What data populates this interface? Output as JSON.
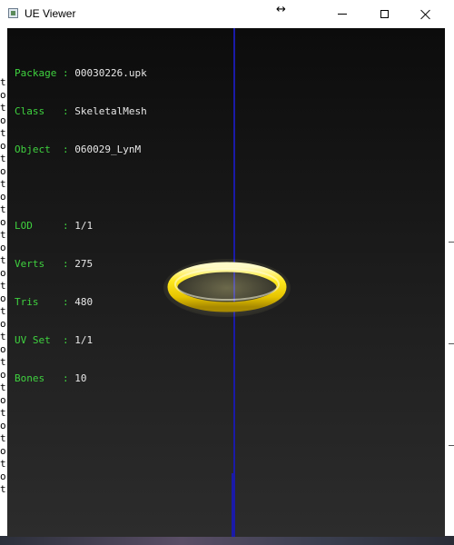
{
  "window": {
    "title": "UE Viewer",
    "icons": {
      "app": "app-window-icon",
      "resize": "horizontal-resize-cursor-icon",
      "minimize": "minimize-icon",
      "maximize": "maximize-icon",
      "close": "close-icon"
    },
    "resize_glyph": "↔"
  },
  "info": {
    "object": [
      {
        "key": "Package",
        "sep": " : ",
        "value": "00030226.upk"
      },
      {
        "key": "Class  ",
        "sep": " : ",
        "value": "SkeletalMesh"
      },
      {
        "key": "Object ",
        "sep": " : ",
        "value": "060029_LynM"
      }
    ],
    "stats": [
      {
        "key": "LOD    ",
        "sep": " : ",
        "value": "1/1"
      },
      {
        "key": "Verts  ",
        "sep": " : ",
        "value": "275"
      },
      {
        "key": "Tris   ",
        "sep": " : ",
        "value": "480"
      },
      {
        "key": "UV Set ",
        "sep": " : ",
        "value": "1/1"
      },
      {
        "key": "Bones  ",
        "sep": " : ",
        "value": "10"
      }
    ]
  },
  "background_text": {
    "stray_letters": [
      "t",
      "o",
      "t",
      "o",
      "t",
      "o",
      "t",
      "o",
      "t",
      "o",
      "t",
      "o",
      "t",
      "o",
      "t",
      "o",
      "t",
      "o",
      "t",
      "o",
      "t",
      "o",
      "t",
      "o",
      "t",
      "o",
      "t",
      "o",
      "t",
      "o",
      "t",
      "o",
      "t"
    ]
  },
  "colors": {
    "label": "#3fd23f",
    "value": "#e8e8e8",
    "axis": "#1a1aa8",
    "mesh": "#ffe21a"
  }
}
